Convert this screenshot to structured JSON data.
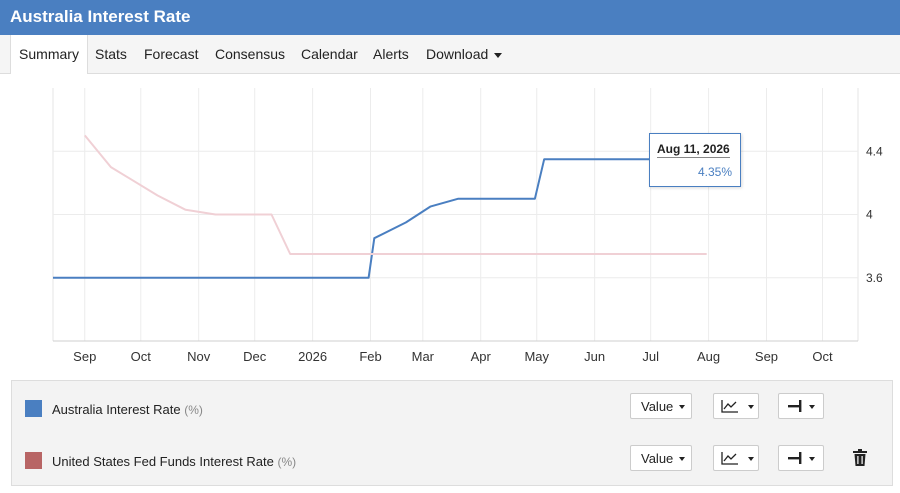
{
  "header": {
    "title": "Australia Interest Rate"
  },
  "tabs": [
    {
      "label": "Summary",
      "active": true
    },
    {
      "label": "Stats"
    },
    {
      "label": "Forecast"
    },
    {
      "label": "Consensus"
    },
    {
      "label": "Calendar"
    },
    {
      "label": "Alerts"
    },
    {
      "label": "Download",
      "dropdown": true
    }
  ],
  "chart_data": {
    "type": "line",
    "x_ticks": [
      "Sep",
      "Oct",
      "Nov",
      "Dec",
      "2026",
      "Feb",
      "Mar",
      "Apr",
      "May",
      "Jun",
      "Jul",
      "Aug",
      "Sep",
      "Oct"
    ],
    "y_ticks": [
      3.6,
      4,
      4.4
    ],
    "ylim": [
      3.2,
      4.8
    ],
    "x_range": [
      "2025-08-15",
      "2026-10-20"
    ],
    "series": [
      {
        "name": "Australia Interest Rate",
        "unit": "(%)",
        "color": "#4a7fc1",
        "points": [
          [
            "2025-08-15",
            3.6
          ],
          [
            "2026-01-31",
            3.6
          ],
          [
            "2026-02-03",
            3.85
          ],
          [
            "2026-02-20",
            3.95
          ],
          [
            "2026-03-05",
            4.05
          ],
          [
            "2026-03-20",
            4.1
          ],
          [
            "2026-04-30",
            4.1
          ],
          [
            "2026-05-05",
            4.35
          ],
          [
            "2026-08-11",
            4.35
          ]
        ]
      },
      {
        "name": "United States Fed Funds Interest Rate",
        "unit": "(%)",
        "color": "#f0d0d5",
        "points": [
          [
            "2025-09-01",
            4.5
          ],
          [
            "2025-09-15",
            4.3
          ],
          [
            "2025-10-10",
            4.12
          ],
          [
            "2025-10-25",
            4.03
          ],
          [
            "2025-11-10",
            4.0
          ],
          [
            "2025-12-10",
            4.0
          ],
          [
            "2025-12-20",
            3.75
          ],
          [
            "2026-07-31",
            3.75
          ]
        ]
      }
    ],
    "tooltip": {
      "date": "Aug 11, 2026",
      "value": "4.35%"
    },
    "grid": true,
    "legend": "bottom"
  },
  "legend_rows": [
    {
      "name": "Australia Interest Rate",
      "unit": "(%)",
      "color": "#4a7fc1",
      "value_label": "Value",
      "deletable": false
    },
    {
      "name": "United States Fed Funds Interest Rate",
      "unit": "(%)",
      "color": "#b86565",
      "value_label": "Value",
      "deletable": true
    }
  ],
  "icons": {
    "chart_type": "line-chart-icon",
    "axis": "axis-side-icon",
    "delete": "trash-icon"
  }
}
